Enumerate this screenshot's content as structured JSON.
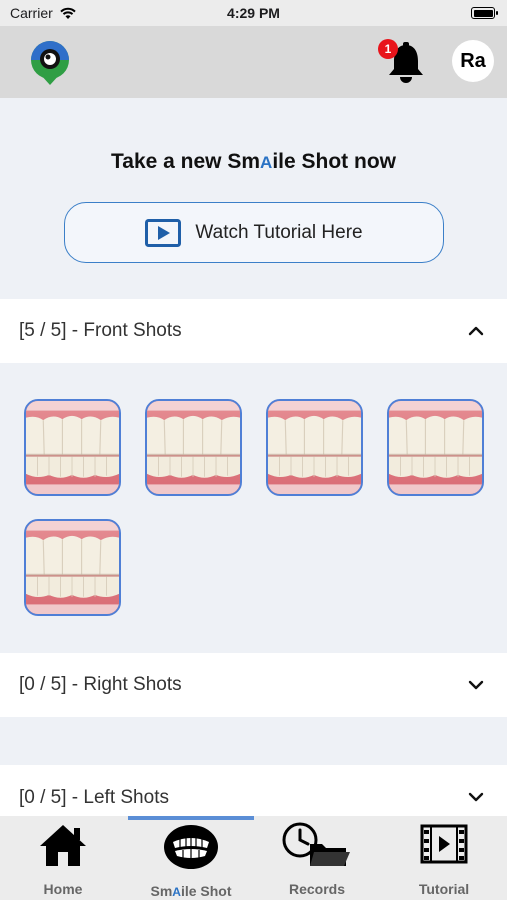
{
  "status_bar": {
    "carrier": "Carrier",
    "time": "4:29 PM"
  },
  "header": {
    "notification_count": "1",
    "avatar_initials": "Ra"
  },
  "main": {
    "headline_before": "Take a new Sm",
    "headline_brand": "A",
    "headline_after": "ile Shot now",
    "tutorial_button": "Watch Tutorial Here"
  },
  "sections": {
    "front": {
      "label": "[5  / 5] - Front Shots",
      "expanded": true,
      "thumbnail_count": 5
    },
    "right": {
      "label": "[0  / 5] - Right Shots",
      "expanded": false
    },
    "left": {
      "label": "[0  / 5] - Left Shots",
      "expanded": false
    }
  },
  "tabs": {
    "home": "Home",
    "smile_before": "Sm",
    "smile_brand": "A",
    "smile_after": "ile Shot",
    "records": "Records",
    "tutorial": "Tutorial",
    "active": "smile-shot"
  },
  "colors": {
    "accent": "#2a72c4",
    "tab_indicator": "#5b8ed6",
    "badge": "#e8141b",
    "thumb_border": "#4f7fd6"
  },
  "icons": [
    "wifi-icon",
    "app-logo-icon",
    "bell-icon",
    "play-icon",
    "chevron-up-icon",
    "chevron-down-icon",
    "home-icon",
    "teeth-icon",
    "records-icon",
    "film-icon"
  ]
}
